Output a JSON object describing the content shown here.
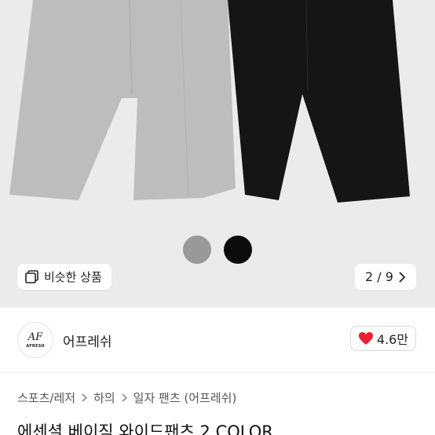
{
  "product": {
    "similar_button_label": "비슷한 상품",
    "image_counter": "2 / 9",
    "title": "에센셜 베이직 와이드팬츠 2 COLOR",
    "swatches": [
      {
        "name": "gray",
        "color": "#999999"
      },
      {
        "name": "black",
        "color": "#0b0b0b"
      }
    ]
  },
  "seller": {
    "name": "어프레쉬",
    "logo_mark": "AF",
    "logo_text": "AFRESH"
  },
  "rating": {
    "value": "4.6만",
    "icon": "heart-icon",
    "color": "#e8202f"
  },
  "breadcrumb": [
    "스포츠/레저",
    "하의",
    "일자 팬츠 (어프레쉬)"
  ],
  "colors": {
    "gallery_bg": "#ebebeb",
    "pants_gray": "#bdbdbd",
    "pants_black": "#151515"
  }
}
